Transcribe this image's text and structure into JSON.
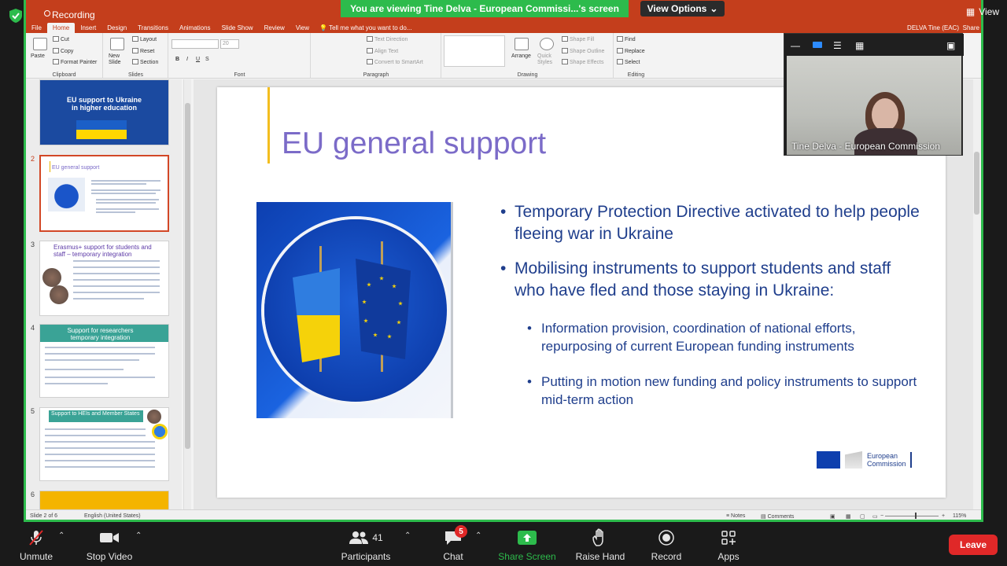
{
  "zoom": {
    "viewing_banner": "You are viewing Tine Delva - European Commissi...'s screen",
    "view_options": "View Options",
    "view_label": "View",
    "video_tile_name": "Tine Delva - European Commission",
    "toolbar": {
      "unmute": "Unmute",
      "stop_video": "Stop Video",
      "participants": "Participants",
      "participants_count": "41",
      "chat": "Chat",
      "chat_badge": "5",
      "share_screen": "Share Screen",
      "raise_hand": "Raise Hand",
      "record": "Record",
      "apps": "Apps",
      "leave": "Leave"
    },
    "colors": {
      "green": "#2dbb4c",
      "red": "#e02828"
    }
  },
  "ppt": {
    "recording_label": "Recording",
    "tabs": [
      "File",
      "Home",
      "Insert",
      "Design",
      "Transitions",
      "Animations",
      "Slide Show",
      "Review",
      "View"
    ],
    "active_tab": "Home",
    "tell_me": "Tell me what you want to do...",
    "user_name": "DELVA Tine (EAC)",
    "share": "Share",
    "ribbon": {
      "paste": "Paste",
      "cut": "Cut",
      "copy": "Copy",
      "format_painter": "Format Painter",
      "clipboard": "Clipboard",
      "new_slide": "New Slide",
      "layout": "Layout",
      "reset": "Reset",
      "section": "Section",
      "slides": "Slides",
      "font_size": "20",
      "font": "Font",
      "text_direction": "Text Direction",
      "align_text": "Align Text",
      "convert_smartart": "Convert to SmartArt",
      "paragraph": "Paragraph",
      "arrange": "Arrange",
      "quick_styles": "Quick Styles",
      "shape_fill": "Shape Fill",
      "shape_outline": "Shape Outline",
      "shape_effects": "Shape Effects",
      "drawing": "Drawing",
      "find": "Find",
      "replace": "Replace",
      "select": "Select",
      "editing": "Editing"
    },
    "thumbnails": [
      {
        "num": "",
        "text": "EU support to Ukraine in higher education"
      },
      {
        "num": "2",
        "title": "EU general support"
      },
      {
        "num": "3",
        "title": "Erasmus+ support for students and staff – temporary integration"
      },
      {
        "num": "4",
        "title": "Support for researchers temporary integration"
      },
      {
        "num": "5",
        "title": "Support to HEIs and Member States"
      },
      {
        "num": "6"
      }
    ],
    "slide": {
      "title": "EU general support",
      "bullets": [
        "Temporary Protection Directive activated to help people fleeing war in Ukraine",
        "Mobilising instruments to support students and staff who have fled and those staying in Ukraine:"
      ],
      "sub_bullets": [
        "Information provision, coordination of national efforts, repurposing of current European funding instruments",
        "Putting in motion new funding and policy instruments to support mid-term action"
      ],
      "logo_line1": "European",
      "logo_line2": "Commission"
    },
    "status": {
      "slide_of": "Slide 2 of 6",
      "language": "English (United States)",
      "notes": "Notes",
      "comments": "Comments",
      "zoom": "115%"
    }
  }
}
